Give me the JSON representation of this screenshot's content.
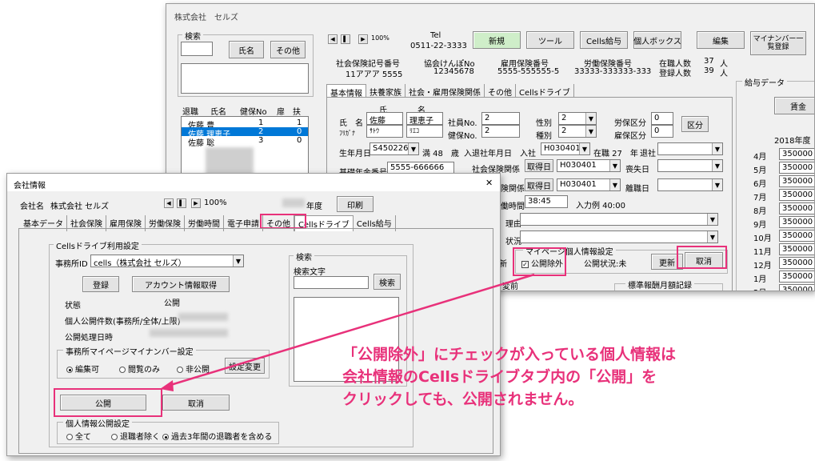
{
  "main_window": {
    "title": "株式会社　セルズ",
    "search": {
      "label": "検索",
      "name_button": "氏名",
      "other_button": "その他"
    },
    "nav": {
      "prev": "◀",
      "pause": "▌",
      "next": "▶",
      "zoom": "100%"
    },
    "tel": {
      "label": "Tel",
      "value": "0511-22-3333"
    },
    "buttons": {
      "new": "新規",
      "tool": "ツール",
      "cells_salary": "Cells給与",
      "personal_box": "個人ボックス",
      "edit": "編集",
      "mynumber": "マイナンバー一覧登録",
      "division": "区分",
      "update": "更新",
      "cancel": "取消"
    },
    "insurance": {
      "social_label": "社会保険記号番号",
      "social_value": "11アアア 5555",
      "kyokai_label": "協会けんぽNo",
      "kyokai_value": "12345678",
      "employment_label": "雇用保険番号",
      "employment_value": "5555-555555-5",
      "labor_label": "労働保険番号",
      "labor_value": "33333-333333-333"
    },
    "counts": {
      "current_label": "在職人数",
      "current_value": "37",
      "current_unit": "人",
      "registered_label": "登録人数",
      "registered_value": "39",
      "registered_unit": "人"
    },
    "list": {
      "headers": [
        "退職",
        "氏名",
        "健保No",
        "扉",
        "扶"
      ],
      "rows": [
        {
          "name": "佐藤 豊",
          "no": "1",
          "c": "1"
        },
        {
          "name": "佐藤 理恵子",
          "no": "2",
          "c": "0"
        },
        {
          "name": "佐藤 聡",
          "no": "3",
          "c": "0"
        }
      ]
    },
    "tabs": [
      "基本情報",
      "扶養家族",
      "社会・雇用保険関係",
      "その他",
      "Cellsドライブ"
    ],
    "form": {
      "col_sei": "氏",
      "col_mei": "名",
      "name_label": "氏　名",
      "sei": "佐藤",
      "mei": "理恵子",
      "furigana_label": "ﾌﾘｶﾞﾅ",
      "furi_sei": "ｻﾄｳ",
      "furi_mei": "ﾘｴｺ",
      "emp_no_label": "社員No.",
      "emp_no": "2",
      "health_no_label": "健保No.",
      "health_no": "2",
      "gender_label": "性別",
      "gender": "2",
      "type_label": "種別",
      "type": "2",
      "labor_div_label": "労保区分",
      "labor_div": "0",
      "emp_div_label": "雇保区分",
      "emp_div": "0",
      "birth_label": "生年月日",
      "birth": "S450226",
      "age_text": "満 48　歳",
      "hire_label": "入退社年月日　入社",
      "hire": "H030401",
      "tenure_text": "在職 27　年",
      "retire_label": "退社",
      "pension_label": "基礎年金番号",
      "pension": "5555-666666",
      "social_rel_label": "社会保険関係",
      "acquire1": "取得日",
      "acquire1_date": "H030401",
      "lose": "喪失日",
      "emp_rel_label": "険関係",
      "acquire2": "取得日",
      "acquire2_date": "H030401",
      "leave": "離職日",
      "work_time_label": "働時間",
      "work_time": "38:45",
      "example_text": "入力例  40:00",
      "reason_label": "理由",
      "status_label": "状況",
      "mypage_group": "マイページ個人情報設定",
      "exclude_public": "公開除外",
      "public_status": "公開状況:未",
      "new_suffix": "新",
      "prev_label": "変前",
      "standard_label": "標準報酬月額記録"
    },
    "salary": {
      "title": "給与データ",
      "wage_button": "賃金",
      "year": "2018年度",
      "months": [
        "4月",
        "5月",
        "6月",
        "7月",
        "8月",
        "9月",
        "10月",
        "11月",
        "12月",
        "1月",
        "2月"
      ],
      "amount": "350000"
    }
  },
  "company_window": {
    "title": "会社情報",
    "company_label": "会社名",
    "company_name": "株式会社 セルズ",
    "nav": {
      "prev": "◀",
      "pause": "▌",
      "next": "▶",
      "zoom": "100%"
    },
    "fiscal_label": "年度",
    "print_button": "印刷",
    "tabs": [
      "基本データ",
      "社会保険",
      "雇用保険",
      "労働保険",
      "労働時間",
      "電子申請",
      "その他",
      "Cellsドライブ",
      "Cells給与"
    ],
    "active_tab": "Cellsドライブ",
    "settings_group": "Cellsドライブ利用設定",
    "office_id_label": "事務所ID",
    "office_id": "cells（株式会社 セルズ）",
    "register_button": "登録",
    "account_button": "アカウント情報取得",
    "state_label": "状態",
    "state_value": "公開",
    "count_label": "個人公開件数(事務所/全体/上限)",
    "processed_label": "公開処理日時",
    "search_group": "検索",
    "search_text_label": "検索文字",
    "search_button": "検索",
    "mypage_group": "事務所マイページマイナンバー設定",
    "radio_edit": "編集可",
    "radio_view": "閲覧のみ",
    "radio_private": "非公開",
    "change_button": "設定変更",
    "publish_button": "公開",
    "cancel_button": "取消",
    "personal_group": "個人情報公開設定",
    "radio_all": "全て",
    "radio_exclude_retired": "退職者除く",
    "radio_past3": "過去3年間の退職者を含める",
    "close": "✕"
  },
  "annotation": {
    "line1": "「公開除外」にチェックが入っている個人情報は",
    "line2": "会社情報のCellsドライブタブ内の「公開」を",
    "line3": "クリックしても、公開されません。",
    "color": "#e8317a"
  }
}
